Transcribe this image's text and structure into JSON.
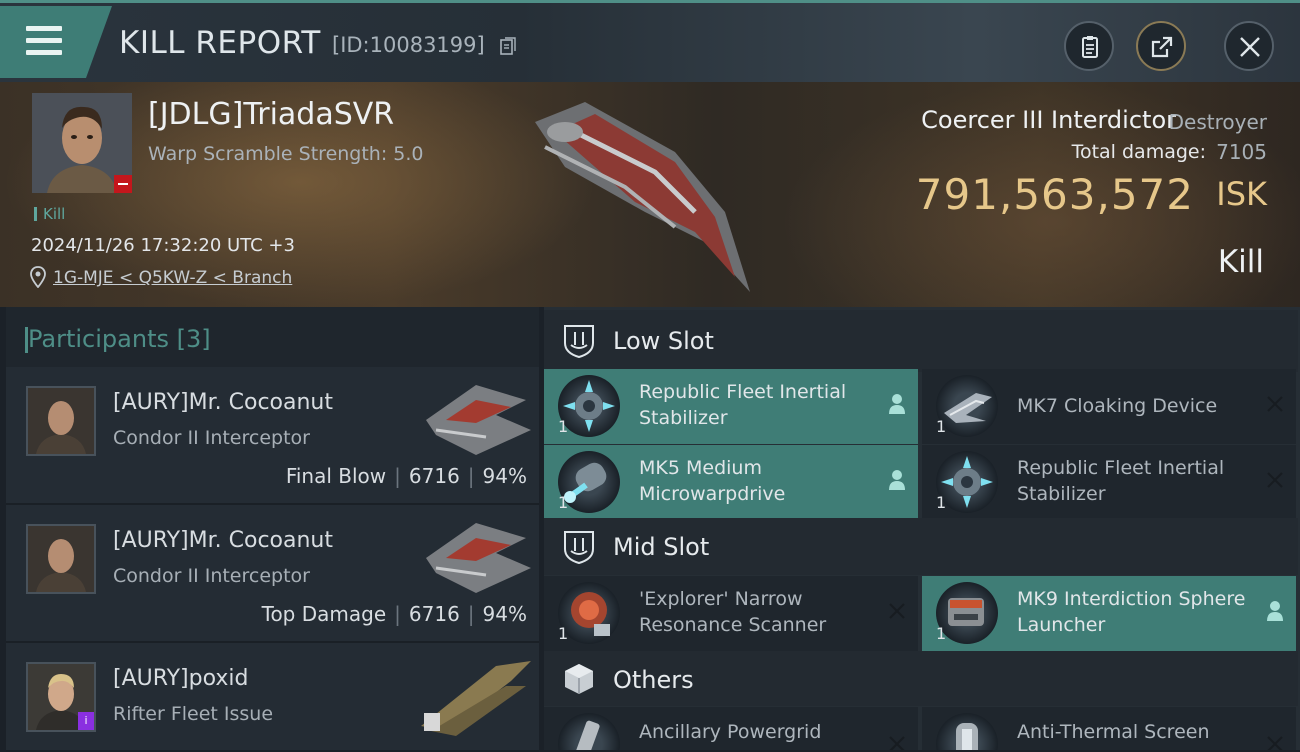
{
  "header": {
    "title": "KILL REPORT",
    "report_id": "[ID:10083199]"
  },
  "victim": {
    "name": "[JDLG]TriadaSVR",
    "warp_scramble": "Warp Scramble Strength: 5.0",
    "tag": "Kill",
    "time": "2024/11/26 17:32:20 UTC +3",
    "location": "1G-MJE < Q5KW-Z < Branch",
    "ship_name": "Coercer III Interdictor",
    "ship_class": "Destroyer",
    "total_damage_label": "Total damage:",
    "total_damage": "7105",
    "isk_value": "791,563,572",
    "isk_unit": "ISK",
    "result": "Kill"
  },
  "participants": {
    "label": "Participants",
    "count": "[3]",
    "items": [
      {
        "name": "[AURY]Mr. Cocoanut",
        "ship": "Condor II Interceptor",
        "role": "Final Blow",
        "damage": "6716",
        "percent": "94%"
      },
      {
        "name": "[AURY]Mr. Cocoanut",
        "ship": "Condor II Interceptor",
        "role": "Top Damage",
        "damage": "6716",
        "percent": "94%"
      },
      {
        "name": "[AURY]poxid",
        "ship": "Rifter Fleet Issue",
        "role": "",
        "damage": "",
        "percent": ""
      }
    ]
  },
  "fittings": {
    "low_slot": {
      "label": "Low Slot",
      "items": [
        {
          "name": "Republic Fleet Inertial Stabilizer",
          "qty": "1",
          "state": "active"
        },
        {
          "name": "MK7 Cloaking Device",
          "qty": "1",
          "state": "destroyed"
        },
        {
          "name": "MK5 Medium Microwarpdrive",
          "qty": "1",
          "state": "active"
        },
        {
          "name": "Republic Fleet Inertial Stabilizer",
          "qty": "1",
          "state": "destroyed"
        }
      ]
    },
    "mid_slot": {
      "label": "Mid Slot",
      "items": [
        {
          "name": "'Explorer' Narrow Resonance Scanner",
          "qty": "1",
          "state": "destroyed"
        },
        {
          "name": "MK9 Interdiction Sphere Launcher",
          "qty": "1",
          "state": "active"
        }
      ]
    },
    "others": {
      "label": "Others",
      "items": [
        {
          "name": "Ancillary Powergrid",
          "qty": "",
          "state": "destroyed"
        },
        {
          "name": "Anti-Thermal Screen",
          "qty": "",
          "state": "destroyed"
        }
      ]
    }
  },
  "colors": {
    "accent": "#3f7d76",
    "isk": "#e6c78a",
    "background": "#1b2128"
  }
}
